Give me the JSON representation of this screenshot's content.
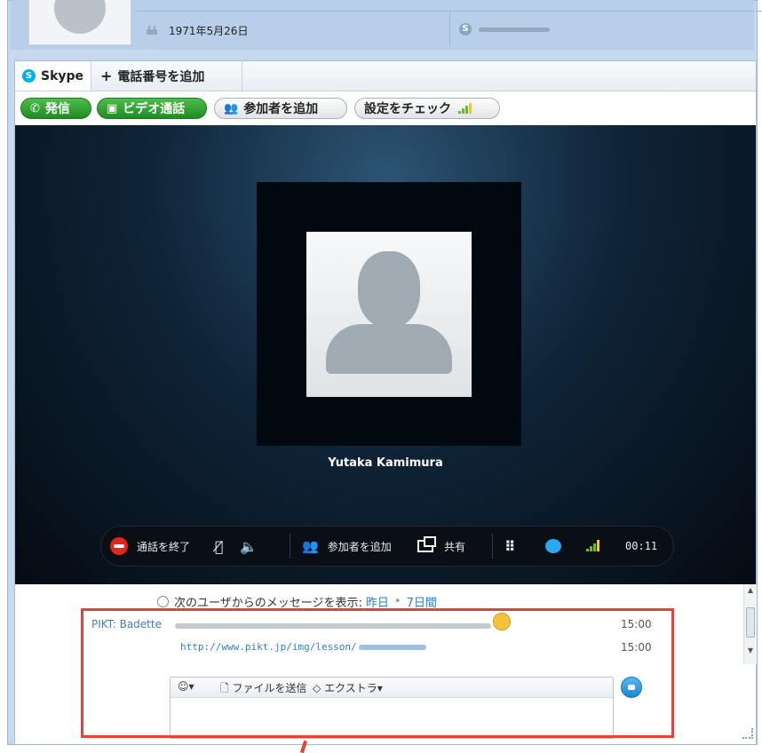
{
  "profile": {
    "birthday": "1971年5月26日",
    "birthday_icon": "cake-icon",
    "skype_id_icon": "skype-icon"
  },
  "tabs": [
    {
      "label": "Skype",
      "icon": "skype-icon"
    },
    {
      "label": "電話番号を追加",
      "icon": "plus-icon"
    }
  ],
  "toolbar": {
    "call_label": "発信",
    "video_label": "ビデオ通話",
    "add_participant_label": "参加者を追加",
    "check_settings_label": "設定をチェック"
  },
  "call": {
    "caller_name": "Yutaka Kamimura",
    "end_call_label": "通話を終了",
    "add_participant_label": "参加者を追加",
    "share_label": "共有",
    "duration": "00:11",
    "signal_color": "#f4c33b"
  },
  "chat": {
    "history_label": "次のユーザからのメッセージを表示:",
    "history_yesterday": "昨日",
    "history_7days": "7日間",
    "messages": [
      {
        "author": "PIKT: Badette",
        "time": "15:00"
      },
      {
        "link": "http://www.pikt.jp/img/lesson/",
        "time": "15:00"
      }
    ],
    "emoji_menu": "☺▾",
    "send_file_label": "ファイルを送信",
    "extras_label": "エクストラ▾"
  },
  "colors": {
    "accent": "#00aff0",
    "call_green": "#2a9f2c",
    "end_red": "#e0261c",
    "highlight": "#e5423a",
    "link": "#2a7fd4"
  }
}
